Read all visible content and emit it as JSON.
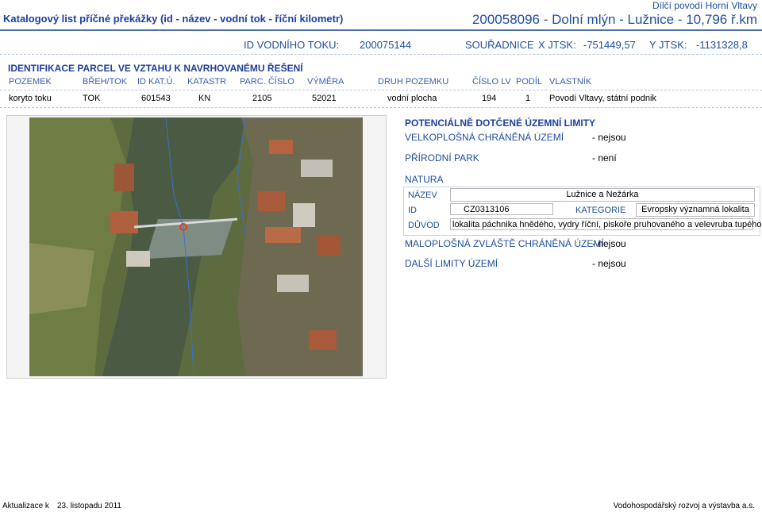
{
  "header": {
    "title": "Katalogový list příčné překážky (id - název - vodní tok - říční kilometr)",
    "subtitle": "Dílčí povodí Horní Vltavy",
    "main": "200058096 - Dolní mlýn - Lužnice - 10,796 ř.km"
  },
  "ids": {
    "vodni_toku_label": "ID VODNÍHO TOKU:",
    "vodni_toku_value": "200075144",
    "souradnice_label": "SOUŘADNICE",
    "x_label": "X JTSK:",
    "x_value": "-751449,57",
    "y_label": "Y JTSK:",
    "y_value": "-1131328,8"
  },
  "parcels": {
    "section_title": "IDENTIFIKACE PARCEL VE VZTAHU K NAVRHOVANÉMU ŘEŠENÍ",
    "columns": [
      "POZEMEK",
      "BŘEH/TOK",
      "ID KAT.Ú.",
      "KATASTR",
      "PARC. ČÍSLO",
      "VÝMĚRA",
      "DRUH POZEMKU",
      "ČÍSLO LV",
      "PODÍL",
      "VLASTNÍK"
    ],
    "row": [
      "koryto toku",
      "TOK",
      "601543",
      "KN",
      "2105",
      "52021",
      "vodní plocha",
      "194",
      "1",
      "Povodí Vltavy, státní podnik"
    ]
  },
  "limits": {
    "title": "POTENCIÁLNĚ DOTČENÉ ÚZEMNÍ LIMITY",
    "vchu_label": "VELKOPLOŠNÁ CHRÁNĚNÁ ÚZEMÍ",
    "vchu_value": "- nejsou",
    "park_label": "PŘÍRODNÍ PARK",
    "park_value": "- není",
    "natura_label": "NATURA",
    "nazev_label": "NÁZEV",
    "nazev_value": "Lužnice a Nežárka",
    "id_label": "ID",
    "id_value": "CZ0313106",
    "kategorie_label": "KATEGORIE",
    "kategorie_value": "Evropsky významná lokalita",
    "duvod_label": "DŮVOD",
    "duvod_value": "lokalita páchnika hnědého, vydry říční, piskoře pruhovaného a velevruba tupého",
    "mzchu_label": "MALOPLOŠNÁ ZVLÁŠTĚ CHRÁNĚNÁ ÚZEMÍ",
    "mzchu_value": "- nejsou",
    "dalsi_label": "DALŠÍ LIMITY ÚZEMÍ",
    "dalsi_value": "- nejsou"
  },
  "footer": {
    "updated_label": "Aktualizace k",
    "updated_date": "23. listopadu 2011",
    "org": "Vodohospodářský rozvoj a výstavba a.s."
  }
}
